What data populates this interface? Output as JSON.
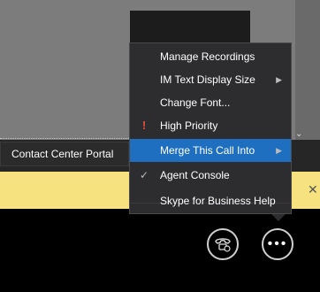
{
  "menu": {
    "items": [
      {
        "label": "Manage Recordings",
        "mark": "",
        "submenu": false,
        "active": false
      },
      {
        "label": "IM Text Display Size",
        "mark": "",
        "submenu": true,
        "active": false
      },
      {
        "label": "Change Font...",
        "mark": "",
        "submenu": false,
        "active": false
      },
      {
        "label": "High Priority",
        "mark": "!",
        "submenu": false,
        "active": false
      },
      {
        "label": "Merge This Call Into",
        "mark": "",
        "submenu": true,
        "active": true
      },
      {
        "label": "Agent Console",
        "mark": "✓",
        "submenu": false,
        "active": false
      },
      {
        "label": "Skype for Business Help",
        "mark": "",
        "submenu": false,
        "active": false
      }
    ]
  },
  "submenu": {
    "items": [
      {
        "label": "Contact Center Portal"
      }
    ]
  },
  "controls": {
    "phone_icon": "call-settings-icon",
    "more_icon": "more-options-icon",
    "more_label": "•••"
  },
  "colors": {
    "menu_bg": "#2d2d30",
    "highlight": "#1e6fbf",
    "priority": "#e84b3c",
    "banner": "#f6e27e"
  }
}
